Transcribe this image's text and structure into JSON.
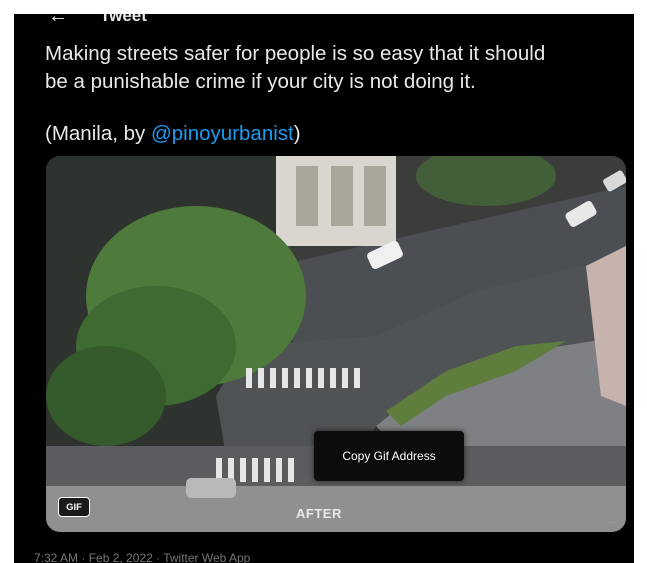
{
  "header": {
    "back_icon": "back-arrow-icon",
    "title": "Tweet"
  },
  "tweet": {
    "text_line1": "Making streets safer for people is so easy that it should",
    "text_line2": "be a punishable crime if your city is not doing it.",
    "credit_prefix": "(Manila, by ",
    "credit_mention": "@pinoyurbanist",
    "credit_suffix": ")",
    "mention_color": "#1d9bf0"
  },
  "media": {
    "gif_badge": "GIF",
    "overlay_label": "AFTER",
    "context_menu_item": "Copy Gif Address"
  },
  "footer": {
    "timestamp": "7:32 AM · Feb 2, 2022 · Twitter Web App"
  }
}
